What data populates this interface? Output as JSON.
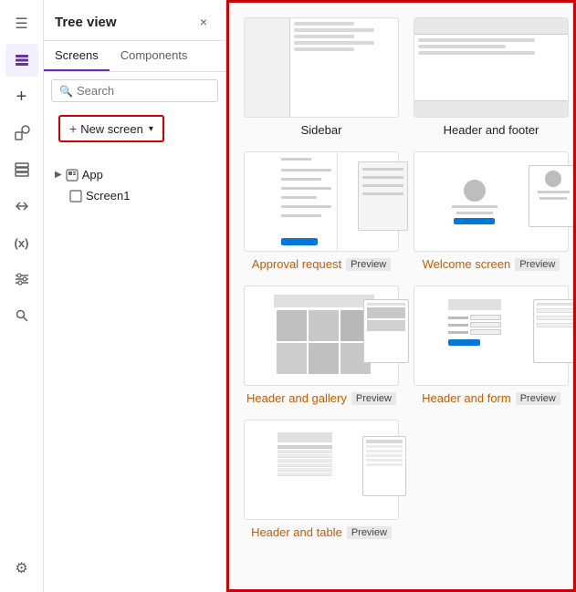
{
  "toolbar": {
    "hamburger_label": "☰",
    "layers_icon": "layers",
    "add_icon": "+",
    "shapes_icon": "shapes",
    "data_icon": "data",
    "arrows_icon": "arrows",
    "vars_icon": "vars",
    "controls_icon": "controls",
    "search_icon": "search",
    "settings_icon": "⚙"
  },
  "panel": {
    "title": "Tree view",
    "close": "×",
    "tabs": [
      "Screens",
      "Components"
    ],
    "active_tab": "Screens",
    "search_placeholder": "Search",
    "new_screen_label": "New screen",
    "tree": {
      "app_label": "App",
      "screen1_label": "Screen1"
    }
  },
  "screens": [
    {
      "id": "sidebar",
      "label": "Sidebar",
      "type": "sidebar",
      "has_preview": false
    },
    {
      "id": "header-footer",
      "label": "Header and footer",
      "type": "header-footer",
      "has_preview": false
    },
    {
      "id": "approval-request",
      "label": "Approval request",
      "type": "approval",
      "has_preview": true
    },
    {
      "id": "welcome-screen",
      "label": "Welcome screen",
      "type": "welcome",
      "has_preview": true
    },
    {
      "id": "header-gallery",
      "label": "Header and gallery",
      "type": "gallery",
      "has_preview": true
    },
    {
      "id": "header-form",
      "label": "Header and form",
      "type": "form",
      "has_preview": true
    },
    {
      "id": "header-table",
      "label": "Header and table",
      "type": "table",
      "has_preview": true
    }
  ],
  "preview_badge": "Preview"
}
